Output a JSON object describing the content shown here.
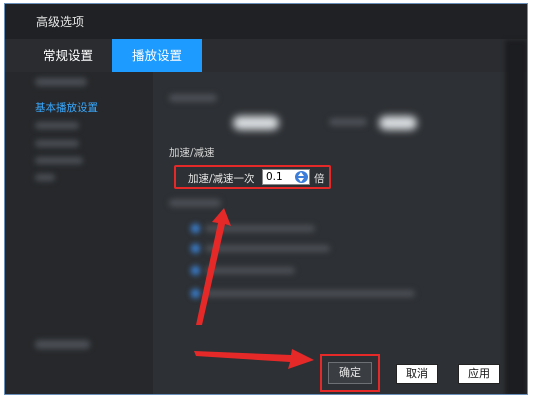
{
  "window": {
    "title": "高级选项"
  },
  "tabs": [
    {
      "label": "常规设置",
      "active": false
    },
    {
      "label": "播放设置",
      "active": true
    }
  ],
  "sidebar": {
    "active_item": "基本播放设置"
  },
  "section": {
    "label": "加速/减速"
  },
  "speed": {
    "label": "加速/减速一次",
    "value": "0.1",
    "unit": "倍"
  },
  "buttons": {
    "ok": "确定",
    "cancel": "取消",
    "apply": "应用"
  },
  "colors": {
    "accent": "#1e9bff",
    "highlight": "#e52929",
    "background": "#2d3034"
  }
}
